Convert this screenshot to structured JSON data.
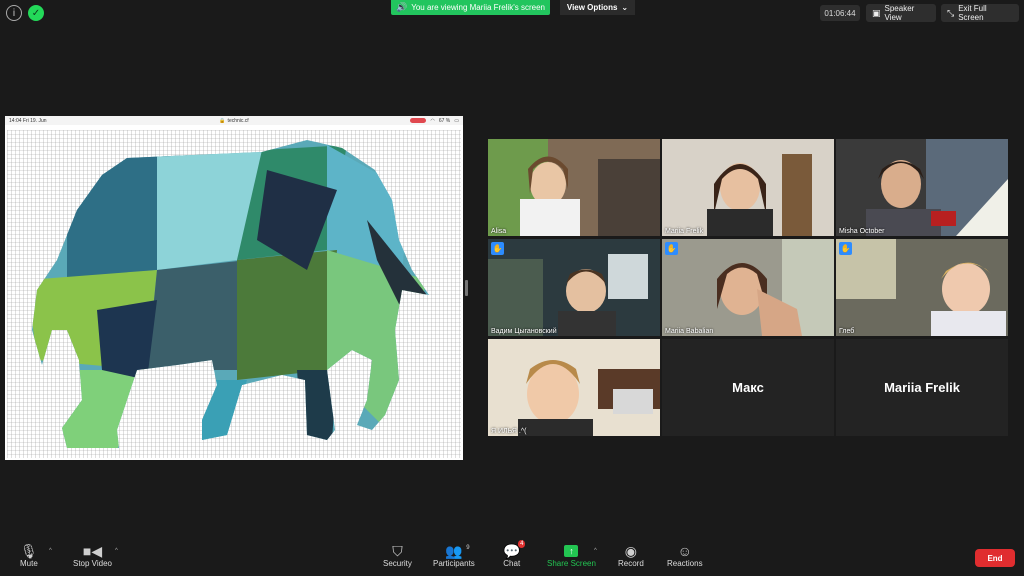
{
  "top": {
    "banner_text": "You are viewing Mariia Frelik's screen",
    "view_options": "View Options",
    "timer": "01:06:44",
    "speaker_view": "Speaker View",
    "exit_full_screen": "Exit Full Screen"
  },
  "ipad": {
    "time": "14:04",
    "date": "Fri 19. Jun",
    "url": "technic.cf",
    "battery": "67 %"
  },
  "participants": [
    {
      "name": "Alisa",
      "hand": false,
      "active": false
    },
    {
      "name": "Mariia Frelik",
      "hand": false,
      "active": false
    },
    {
      "name": "Misha October",
      "hand": false,
      "active": true
    },
    {
      "name": "Вадим Цыгановский",
      "hand": true,
      "active": false
    },
    {
      "name": "Mariia Babalian",
      "hand": true,
      "active": false
    },
    {
      "name": "Глеб",
      "hand": true,
      "active": false
    },
    {
      "name": "Я ИЛЬЯ .^(",
      "hand": false,
      "active": false
    },
    {
      "name": "Макс",
      "hand": false,
      "active": false
    },
    {
      "name": "Mariia Frelik",
      "hand": false,
      "active": false
    }
  ],
  "toolbar": {
    "mute": "Mute",
    "stop_video": "Stop Video",
    "security": "Security",
    "participants": "Participants",
    "participants_count": "9",
    "chat": "Chat",
    "chat_badge": "4",
    "share_screen": "Share Screen",
    "record": "Record",
    "reactions": "Reactions",
    "end": "End"
  },
  "colors": {
    "share_green": "#22c55e",
    "active_speaker": "#e3f06d",
    "end_red": "#e02d2f"
  }
}
